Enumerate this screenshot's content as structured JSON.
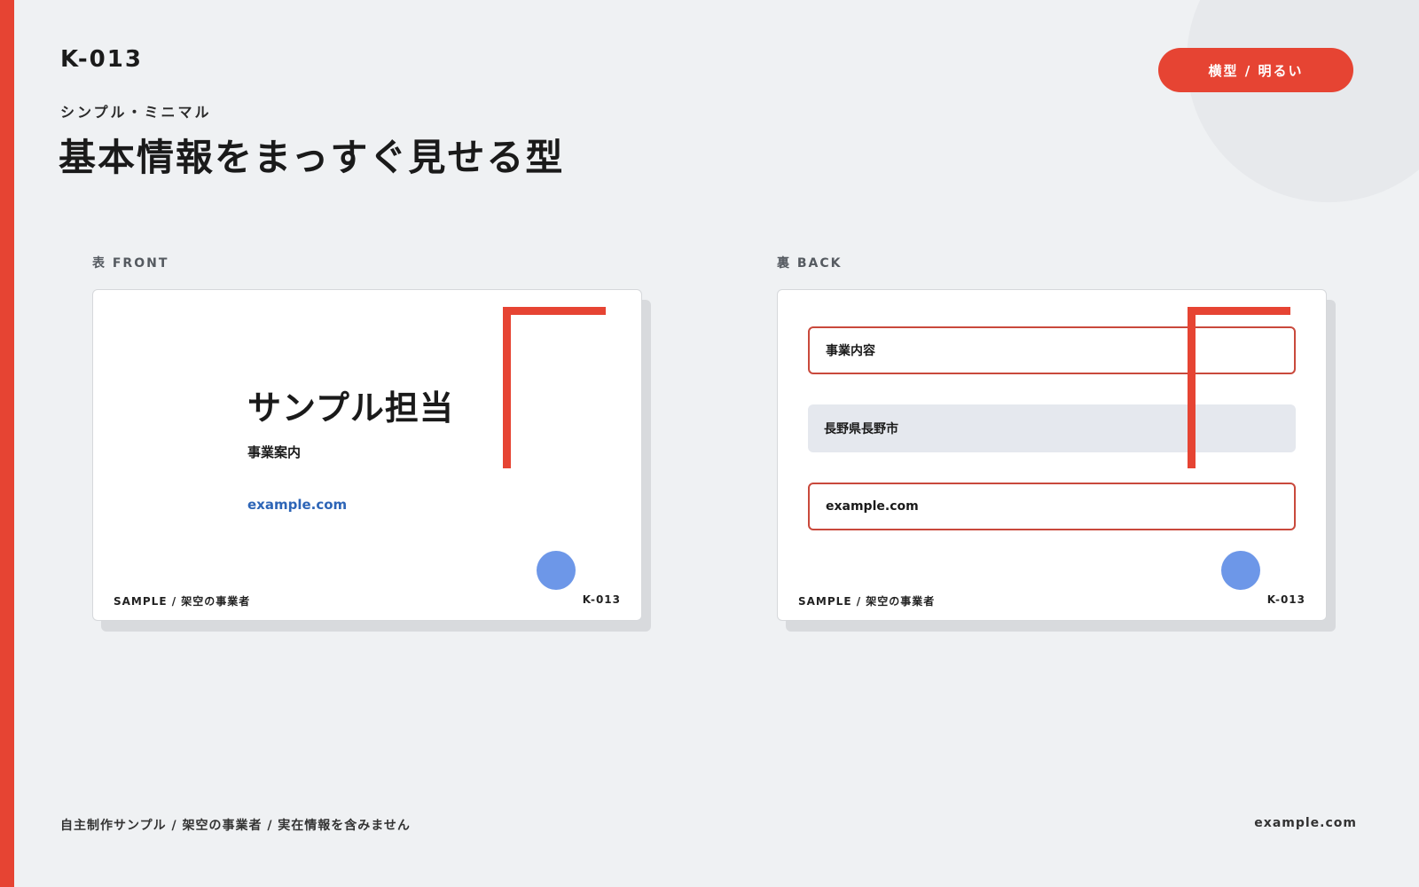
{
  "header": {
    "code": "K-013",
    "subtitle": "シンプル・ミニマル",
    "title": "基本情報をまっすぐ見せる型",
    "badge": "横型 / 明るい"
  },
  "front": {
    "label": "表 FRONT",
    "name": "サンプル担当",
    "role": "事業案内",
    "website": "example.com",
    "footer_left": "SAMPLE / 架空の事業者",
    "footer_right": "K-013"
  },
  "back": {
    "label": "裏 BACK",
    "rows": [
      {
        "text": "事業内容"
      },
      {
        "text": "長野県長野市"
      },
      {
        "text": "example.com"
      }
    ],
    "footer_left": "SAMPLE / 架空の事業者",
    "footer_right": "K-013"
  },
  "footer": {
    "left": "自主制作サンプル / 架空の事業者 / 実在情報を含みません",
    "right": "example.com"
  },
  "colors": {
    "accent": "#e64433",
    "dot": "#6d97e8",
    "link": "#2d65b7",
    "background": "#eff1f3"
  }
}
